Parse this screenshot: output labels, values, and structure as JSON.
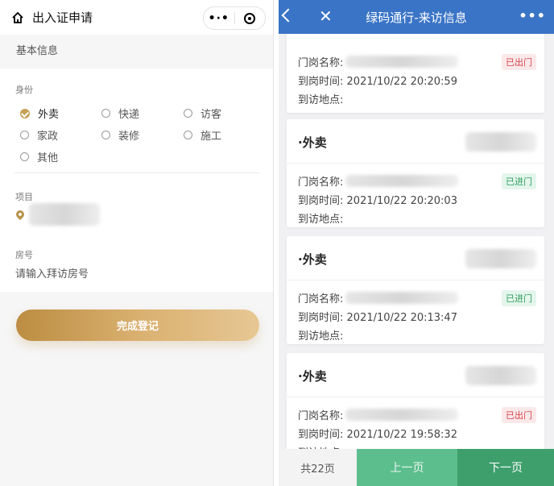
{
  "left": {
    "title": "出入证申请",
    "section": "基本信息",
    "identity": {
      "label": "身份",
      "options": [
        "外卖",
        "快递",
        "访客",
        "家政",
        "装修",
        "施工",
        "其他"
      ],
      "selected": "外卖"
    },
    "project": {
      "label": "项目"
    },
    "room": {
      "label": "房号",
      "placeholder": "请输入拜访房号"
    },
    "submit": "完成登记"
  },
  "right": {
    "title": "绿码通行-来访信息",
    "labels": {
      "gate": "门岗名称:",
      "time": "到岗时间:",
      "place": "到访地点:"
    },
    "records": [
      {
        "title": "",
        "status": "已出门",
        "time": "2021/10/22 20:20:59",
        "status_type": "out"
      },
      {
        "title": "·外卖",
        "status": "已进门",
        "time": "2021/10/22 20:20:03",
        "status_type": "in"
      },
      {
        "title": "·外卖",
        "status": "已进门",
        "time": "2021/10/22 20:13:47",
        "status_type": "in"
      },
      {
        "title": "·外卖",
        "status": "已出门",
        "time": "2021/10/22 19:58:32",
        "status_type": "out"
      }
    ],
    "pager": {
      "total": "共22页",
      "prev": "上一页",
      "next": "下一页"
    }
  },
  "colors": {
    "gold": "#c7a155",
    "blue": "#3a74c6",
    "green": "#5dbe8d",
    "red": "#d4434c"
  }
}
